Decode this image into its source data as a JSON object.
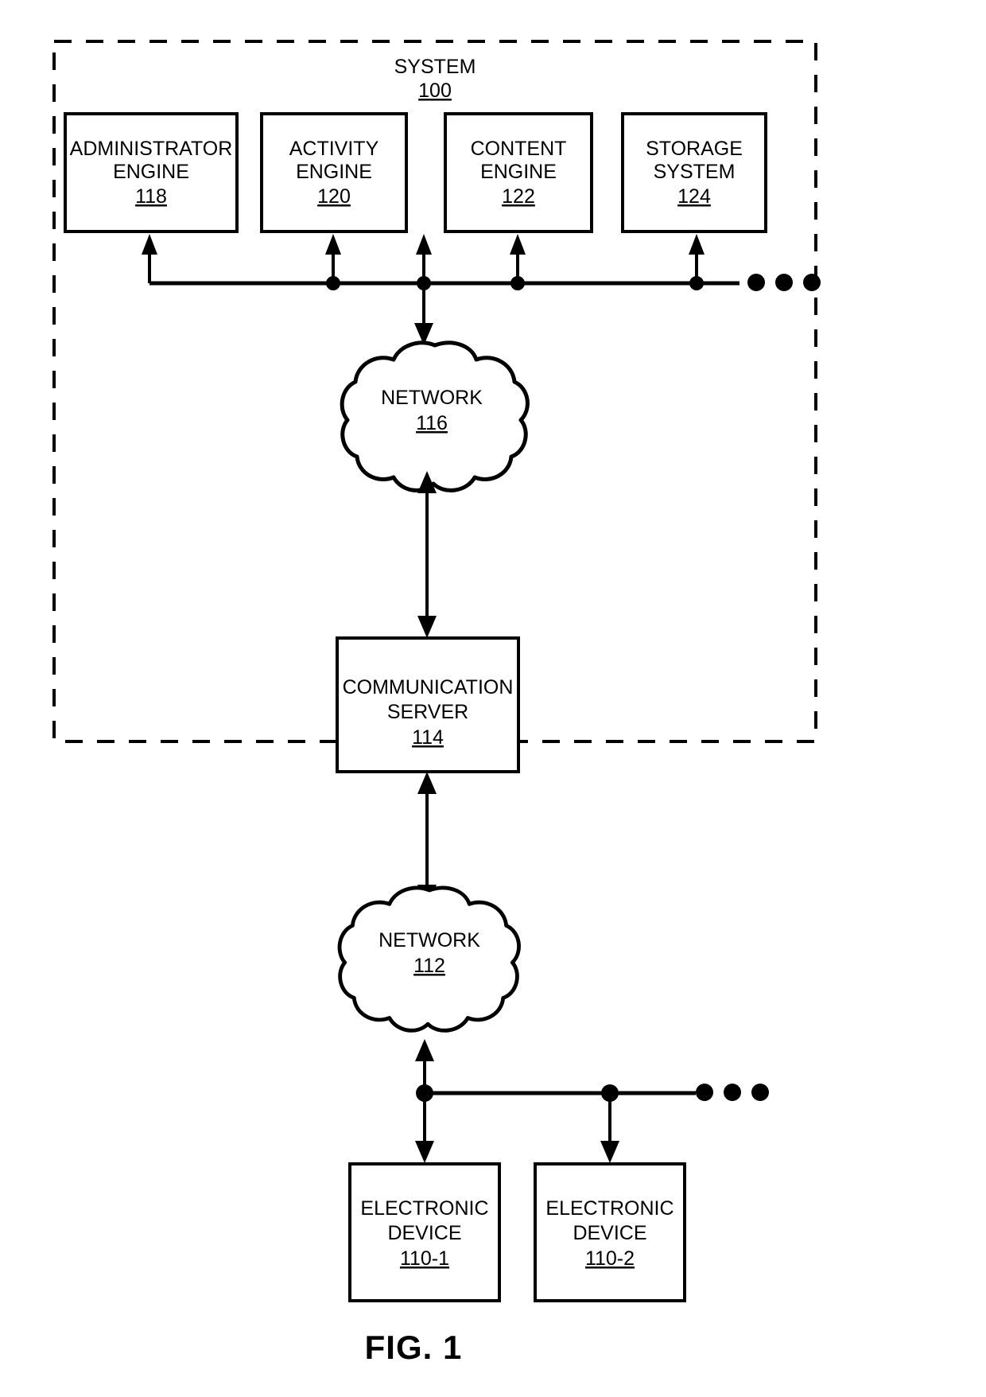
{
  "figure": {
    "caption": "FIG. 1",
    "system_boundary": {
      "title": "SYSTEM",
      "ref": "100"
    }
  },
  "colors": {
    "stroke": "#000000",
    "fill": "#ffffff"
  },
  "engines": [
    {
      "line1": "ADMINISTRATOR",
      "line2": "ENGINE",
      "ref": "118"
    },
    {
      "line1": "ACTIVITY",
      "line2": "ENGINE",
      "ref": "120"
    },
    {
      "line1": "CONTENT",
      "line2": "ENGINE",
      "ref": "122"
    },
    {
      "line1": "STORAGE",
      "line2": "SYSTEM",
      "ref": "124"
    }
  ],
  "networks": [
    {
      "label": "NETWORK",
      "ref": "116"
    },
    {
      "label": "NETWORK",
      "ref": "112"
    }
  ],
  "communication_server": {
    "line1": "COMMUNICATION",
    "line2": "SERVER",
    "ref": "114"
  },
  "electronic_devices": [
    {
      "line1": "ELECTRONIC",
      "line2": "DEVICE",
      "ref": "110-1"
    },
    {
      "line1": "ELECTRONIC",
      "line2": "DEVICE",
      "ref": "110-2"
    }
  ],
  "ellipses": [
    {
      "name": "upper-bus-ellipsis",
      "dots": 3
    },
    {
      "name": "lower-bus-ellipsis",
      "dots": 3
    }
  ]
}
